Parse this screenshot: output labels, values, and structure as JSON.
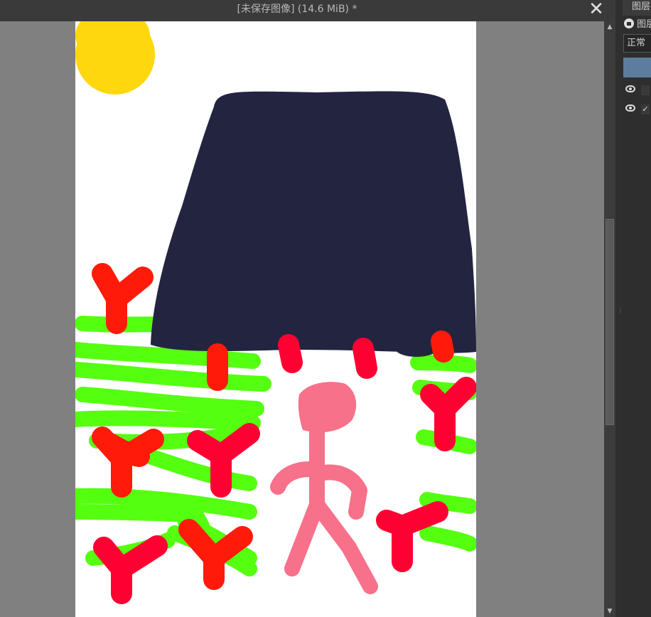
{
  "window": {
    "title": "[未保存图像]  (14.6 MiB) *",
    "close_label": "✕"
  },
  "layers_panel": {
    "tab_label": "图层",
    "filter_label": "图层",
    "blend_mode": "正常",
    "layers": [
      {
        "visible": true,
        "checked": false
      },
      {
        "visible": true,
        "checked": true,
        "check_mark": "✓"
      }
    ]
  },
  "scrollbar": {
    "up_arrow": "▲",
    "down_arrow": "▼"
  },
  "colors": {
    "titlebar": "#3a3a3a",
    "workspace": "#808080",
    "canvas": "#ffffff",
    "navy_shape": "#232440",
    "sun": "#ffd70f",
    "grass": "#55ff10",
    "flower_red": "#ff1a0a",
    "flower_crimson": "#ff0033",
    "figure_pink": "#f7718a",
    "selected_layer": "#5d7d9f"
  }
}
